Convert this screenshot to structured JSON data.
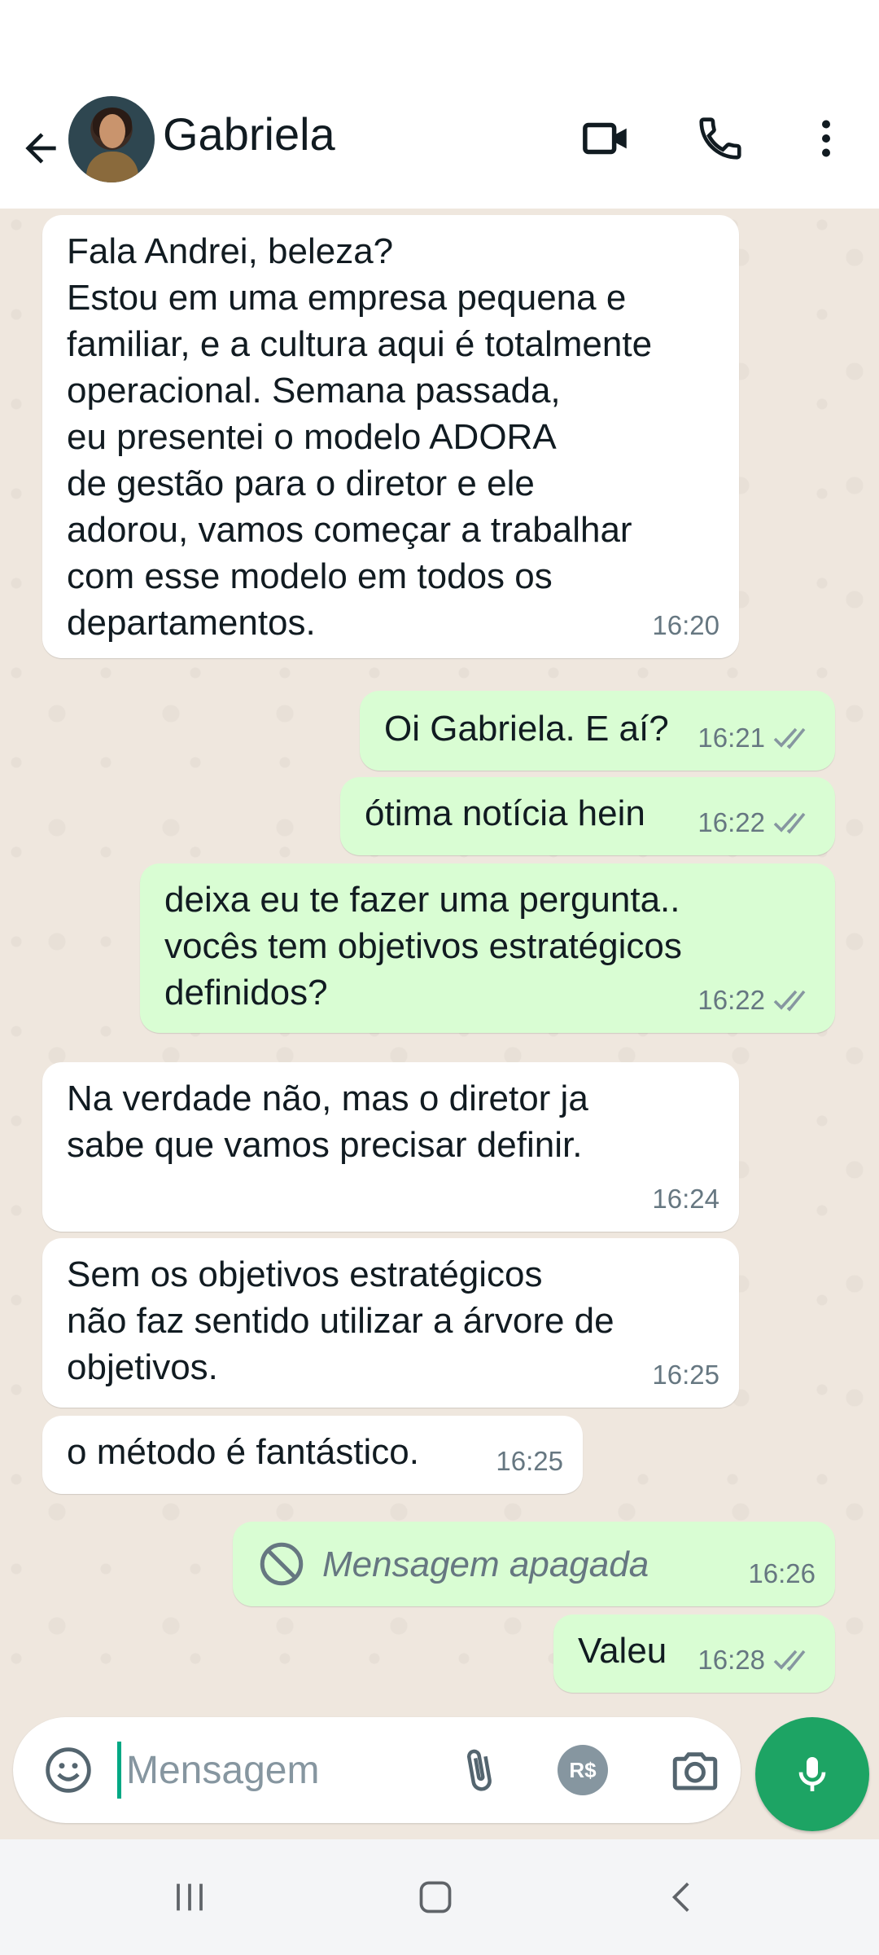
{
  "header": {
    "contact_name": "Gabriela",
    "icons": [
      "back-arrow-icon",
      "video-call-icon",
      "phone-call-icon",
      "more-options-icon"
    ]
  },
  "messages": [
    {
      "direction": "in",
      "text": "Fala Andrei, beleza?\nEstou em uma empresa pequena e\nfamiliar, e a cultura aqui é totalmente\noperacional. Semana passada,\neu presentei o modelo ADORA\nde gestão para o diretor e ele\nadorou, vamos começar a trabalhar\ncom esse modelo em todos os\ndepartamentos.",
      "time": "16:20"
    },
    {
      "direction": "out",
      "text": "Oi Gabriela. E aí?",
      "time": "16:21",
      "status": "read"
    },
    {
      "direction": "out",
      "text": "ótima notícia hein",
      "time": "16:22",
      "status": "read"
    },
    {
      "direction": "out",
      "text": "deixa eu te fazer uma pergunta..\nvocês tem objetivos estratégicos\ndefinidos?",
      "time": "16:22",
      "status": "read"
    },
    {
      "direction": "in",
      "text": "Na verdade não, mas o diretor ja\nsabe que vamos precisar definir.",
      "time": "16:24"
    },
    {
      "direction": "in",
      "text": "Sem os objetivos estratégicos\nnão faz sentido utilizar a árvore de\nobjetivos.",
      "time": "16:25"
    },
    {
      "direction": "in",
      "text": "o método é fantástico.",
      "time": "16:25"
    },
    {
      "direction": "out",
      "text": "Mensagem apagada",
      "time": "16:26",
      "deleted": true
    },
    {
      "direction": "out",
      "text": "Valeu",
      "time": "16:28",
      "status": "read"
    }
  ],
  "input": {
    "placeholder": "Mensagem",
    "value": "",
    "pay_label": "R$"
  },
  "colors": {
    "incoming_bubble": "#ffffff",
    "outgoing_bubble": "#d9fdd3",
    "chat_background": "#efe7de",
    "mic_button": "#1da464",
    "read_ticks": "#8696a0"
  }
}
